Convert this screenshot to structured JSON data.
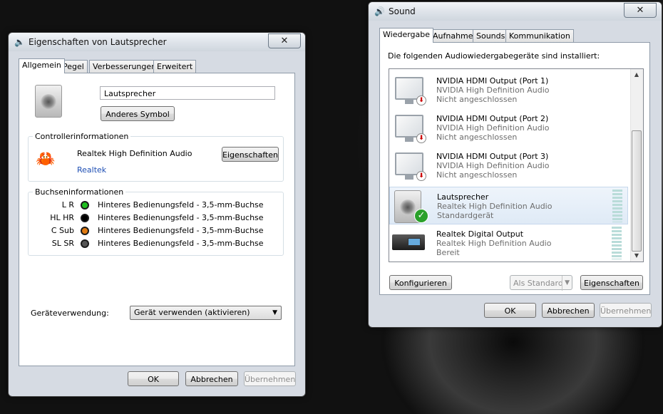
{
  "left_window": {
    "title": "Eigenschaften von Lautsprecher",
    "close": "✕",
    "tabs": [
      "Allgemein",
      "Pegel",
      "Verbesserungen",
      "Erweitert"
    ],
    "device_name_value": "Lautsprecher",
    "change_icon_button": "Anderes Symbol",
    "controller": {
      "group_label": "Controllerinformationen",
      "name": "Realtek High Definition Audio",
      "link": "Realtek",
      "properties_button": "Eigenschaften"
    },
    "jacks": {
      "group_label": "Buchseninformationen",
      "rows": [
        {
          "code": "L R",
          "desc": "Hinteres Bedienungsfeld - 3,5-mm-Buchse",
          "color": "#1fbf1f"
        },
        {
          "code": "HL HR",
          "desc": "Hinteres Bedienungsfeld - 3,5-mm-Buchse",
          "color": "#000000"
        },
        {
          "code": "C Sub",
          "desc": "Hinteres Bedienungsfeld - 3,5-mm-Buchse",
          "color": "#e07a10"
        },
        {
          "code": "SL SR",
          "desc": "Hinteres Bedienungsfeld - 3,5-mm-Buchse",
          "color": "#555555"
        }
      ]
    },
    "usage_label": "Geräteverwendung:",
    "usage_value": "Gerät verwenden (aktivieren)",
    "ok": "OK",
    "cancel": "Abbrechen",
    "apply": "Übernehmen"
  },
  "right_window": {
    "title": "Sound",
    "close": "✕",
    "tabs": [
      "Wiedergabe",
      "Aufnahme",
      "Sounds",
      "Kommunikation"
    ],
    "intro": "Die folgenden Audiowiedergabegeräte sind installiert:",
    "devices": [
      {
        "name": "NVIDIA HDMI Output (Port 1)",
        "driver": "NVIDIA High Definition Audio",
        "status": "Nicht angeschlossen"
      },
      {
        "name": "NVIDIA HDMI Output (Port 2)",
        "driver": "NVIDIA High Definition Audio",
        "status": "Nicht angeschlossen"
      },
      {
        "name": "NVIDIA HDMI Output (Port 3)",
        "driver": "NVIDIA High Definition Audio",
        "status": "Nicht angeschlossen"
      },
      {
        "name": "Lautsprecher",
        "driver": "Realtek High Definition Audio",
        "status": "Standardgerät"
      },
      {
        "name": "Realtek Digital Output",
        "driver": "Realtek High Definition Audio",
        "status": "Bereit"
      }
    ],
    "configure_button": "Konfigurieren",
    "default_button": "Als Standard",
    "properties_button": "Eigenschaften",
    "ok": "OK",
    "cancel": "Abbrechen",
    "apply": "Übernehmen"
  },
  "colors": {
    "link": "#1f4fb4",
    "meter": "#b9dcd9",
    "default_check": "#2aa02a",
    "disconnected": "#cc0000"
  }
}
